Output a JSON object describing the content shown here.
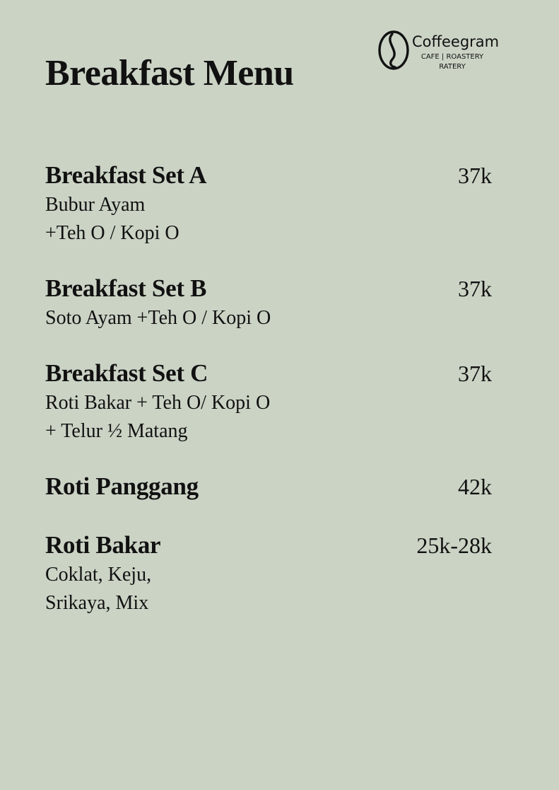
{
  "page": {
    "title": "Breakfast Menu"
  },
  "logo": {
    "name": "Coffeegram",
    "tagline_line1": "CAFE | ROASTERY",
    "tagline_line2": "RATERY",
    "icon": "coffee-bean-icon"
  },
  "menu": {
    "items": [
      {
        "name": "Breakfast Set A",
        "price": "37k",
        "description": [
          "Bubur Ayam",
          "+Teh O / Kopi O"
        ]
      },
      {
        "name": "Breakfast Set B",
        "price": "37k",
        "description": [
          "Soto Ayam +Teh O / Kopi O"
        ]
      },
      {
        "name": "Breakfast Set C",
        "price": "37k",
        "description": [
          "Roti Bakar + Teh O/ Kopi O",
          "+ Telur ½ Matang"
        ]
      },
      {
        "name": "Roti Panggang",
        "price": "42k",
        "description": []
      },
      {
        "name": "Roti Bakar",
        "price": "25k-28k",
        "description": [
          "Coklat, Keju,",
          "Srikaya, Mix"
        ]
      }
    ]
  },
  "colors": {
    "background": "#cbd3c5",
    "text": "#111111"
  }
}
